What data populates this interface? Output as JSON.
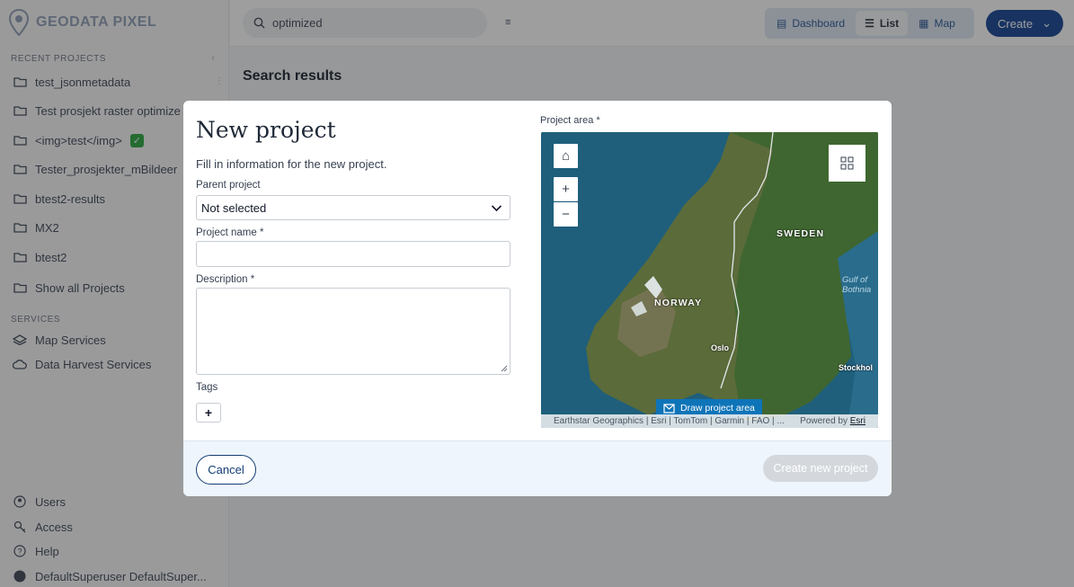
{
  "app": {
    "name": "GEODATA PIXEL"
  },
  "sidebar": {
    "recent_label": "RECENT PROJECTS",
    "recent": [
      {
        "label": "test_jsonmetadata",
        "icon": "folder-icon"
      },
      {
        "label": "Test prosjekt raster optimize",
        "icon": "folder-icon"
      },
      {
        "label": "<img>test</img>",
        "icon": "folder-icon",
        "badge": "✓"
      },
      {
        "label": "Tester_prosjekter_mBildeer",
        "icon": "folder-icon"
      },
      {
        "label": "btest2-results",
        "icon": "folder-icon"
      },
      {
        "label": "MX2",
        "icon": "folder-icon"
      },
      {
        "label": "btest2",
        "icon": "folder-icon"
      },
      {
        "label": "Show all Projects",
        "icon": "folder-icon"
      }
    ],
    "services_label": "SERVICES",
    "services": [
      {
        "label": "Map Services",
        "icon": "layers-icon"
      },
      {
        "label": "Data Harvest Services",
        "icon": "cloud-icon"
      }
    ],
    "bottom": [
      {
        "label": "Users",
        "icon": "user-icon"
      },
      {
        "label": "Access",
        "icon": "key-icon"
      },
      {
        "label": "Help",
        "icon": "help-icon"
      },
      {
        "label": "DefaultSuperuser DefaultSuper...",
        "icon": "globe-icon"
      }
    ]
  },
  "topbar": {
    "search_value": "optimized",
    "views": [
      {
        "label": "Dashboard",
        "icon": "dashboard-icon",
        "active": false
      },
      {
        "label": "List",
        "icon": "list-icon",
        "active": true
      },
      {
        "label": "Map",
        "icon": "map-icon",
        "active": false
      }
    ],
    "create_label": "Create"
  },
  "main": {
    "title": "Search results"
  },
  "modal": {
    "title": "New project",
    "subtitle": "Fill in information for the new project.",
    "parent_label": "Parent project",
    "parent_value": "Not selected",
    "name_label": "Project name *",
    "name_value": "",
    "description_label": "Description *",
    "description_value": "",
    "tags_label": "Tags",
    "tag_add": "+",
    "map_label": "Project area *",
    "map": {
      "zoom_in": "+",
      "zoom_out": "−",
      "labels": {
        "sweden": "SWEDEN",
        "norway": "NORWAY",
        "oslo": "Oslo",
        "stockholm": "Stockhol",
        "gulf": "Gulf of Bothnia"
      },
      "draw_label": "Draw project area",
      "attribution": "Earthstar Geographics | Esri | TomTom | Garmin | FAO | ...",
      "powered_by": "Powered by",
      "powered_by_link": "Esri"
    },
    "cancel_label": "Cancel",
    "create_label": "Create new project"
  },
  "colors": {
    "primary": "#0b3d91",
    "overlay": "rgba(40,40,40,0.45)",
    "disabled": "#d4d8dd",
    "footer_bg": "#eef5fc"
  }
}
